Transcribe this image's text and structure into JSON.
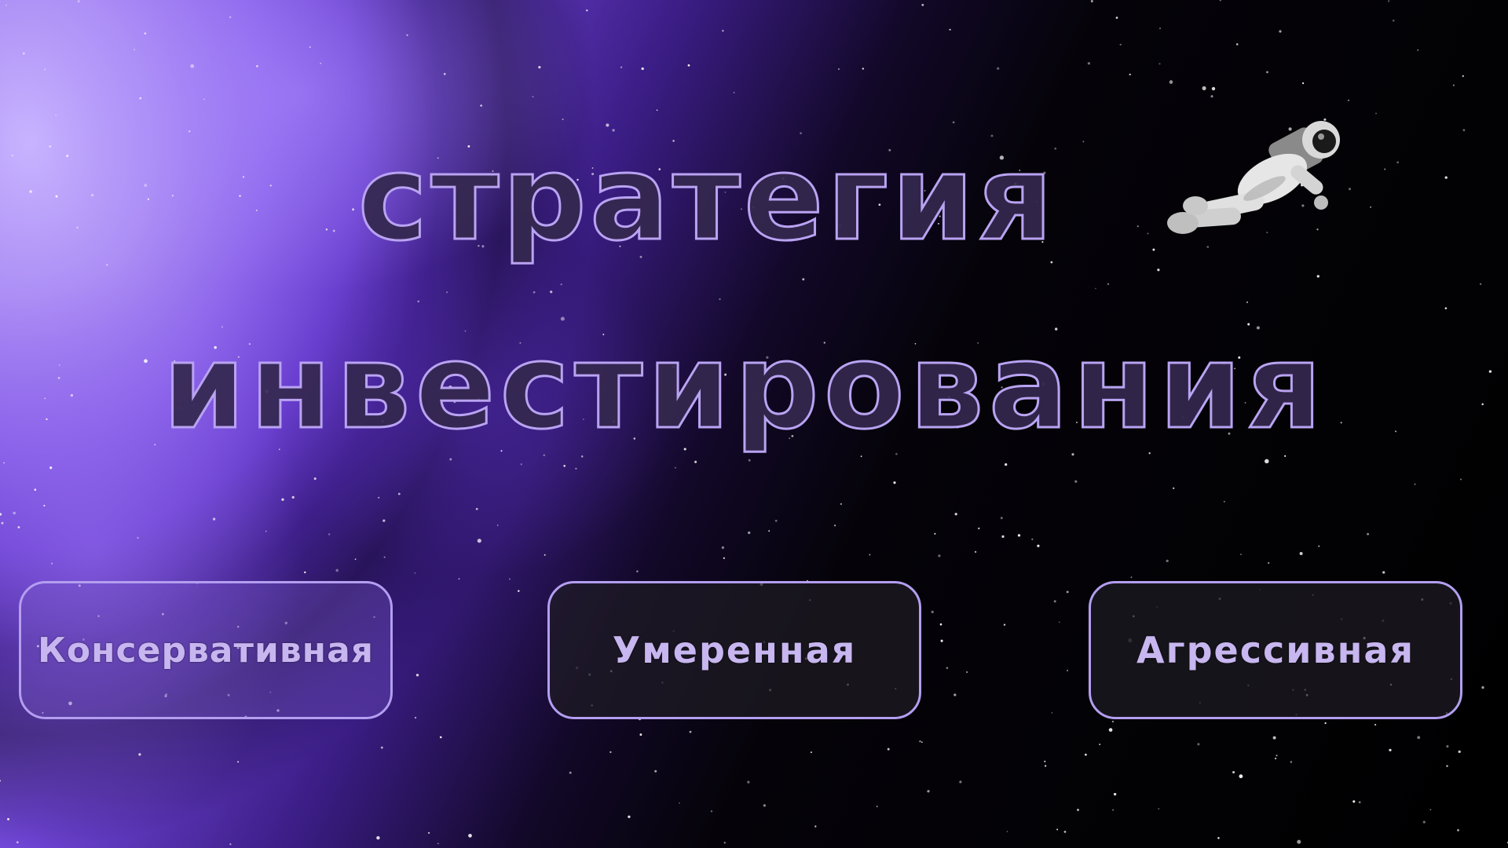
{
  "title": {
    "line1": "стратегия",
    "line2": "инвестирования"
  },
  "options": [
    {
      "label": "Консервативная"
    },
    {
      "label": "Умеренная"
    },
    {
      "label": "Агрессивная"
    }
  ],
  "colors": {
    "accent": "#b9a3f2",
    "button_border": "#b39ef0",
    "button_text": "#c7b6ef",
    "nebula": "#8b63ea",
    "background": "#000000"
  },
  "icons": {
    "decoration": "astronaut-icon"
  }
}
